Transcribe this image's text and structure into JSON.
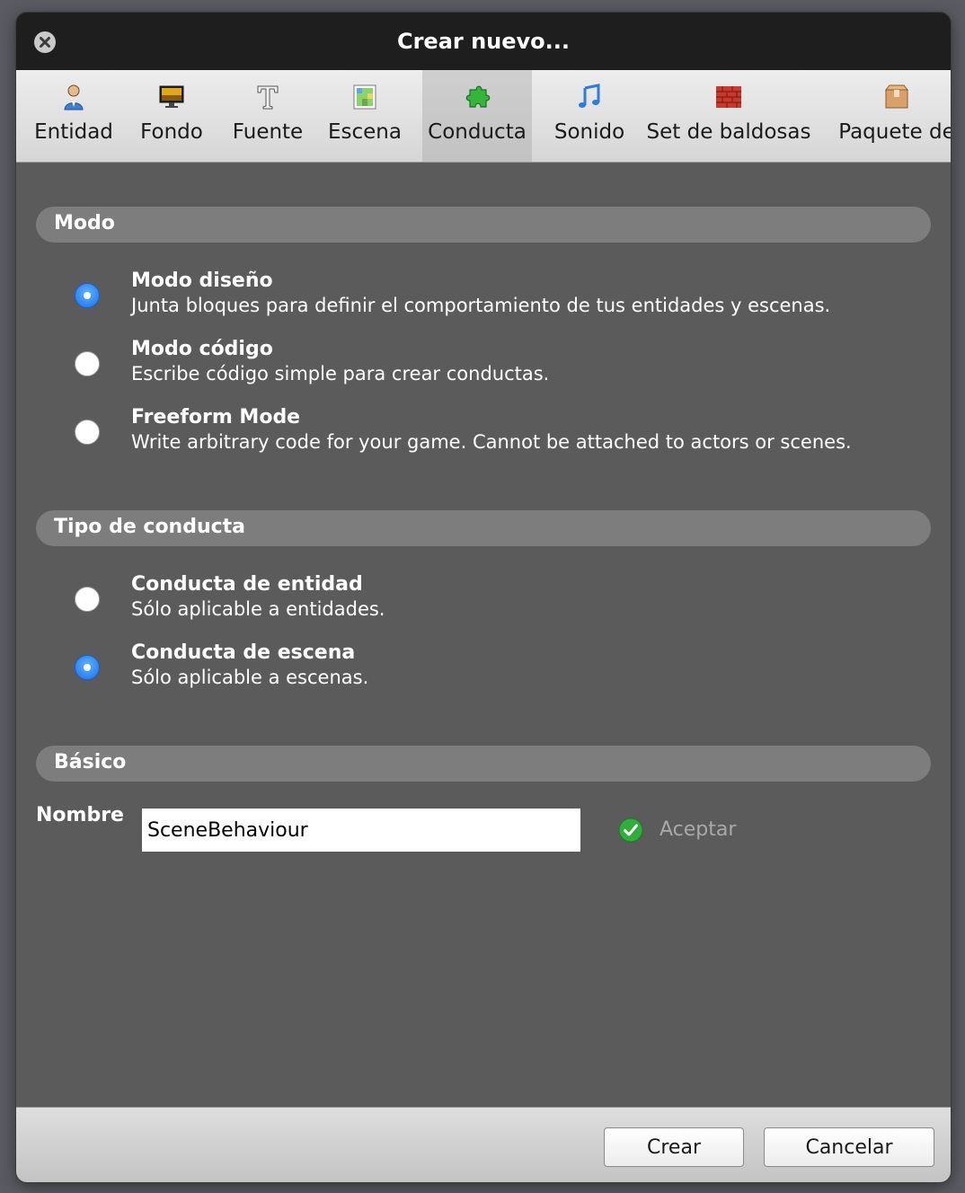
{
  "window": {
    "title": "Crear nuevo..."
  },
  "tabs": [
    {
      "label": "Entidad",
      "icon": "actor-icon"
    },
    {
      "label": "Fondo",
      "icon": "background-icon"
    },
    {
      "label": "Fuente",
      "icon": "font-icon"
    },
    {
      "label": "Escena",
      "icon": "scene-icon"
    },
    {
      "label": "Conducta",
      "icon": "behavior-icon",
      "active": true
    },
    {
      "label": "Sonido",
      "icon": "sound-icon"
    },
    {
      "label": "Set de baldosas",
      "icon": "tileset-icon"
    },
    {
      "label": "Paquete de",
      "icon": "package-icon"
    }
  ],
  "mode": {
    "header": "Modo",
    "options": [
      {
        "title": "Modo diseño",
        "desc": "Junta bloques para definir el comportamiento de tus entidades y escenas.",
        "checked": true
      },
      {
        "title": "Modo código",
        "desc": "Escribe código simple para crear conductas.",
        "checked": false
      },
      {
        "title": "Freeform Mode",
        "desc": "Write arbitrary code for your game. Cannot be attached to actors or scenes.",
        "checked": false
      }
    ]
  },
  "behavior_type": {
    "header": "Tipo de conducta",
    "options": [
      {
        "title": "Conducta de entidad",
        "desc": "Sólo aplicable a entidades.",
        "checked": false
      },
      {
        "title": "Conducta de escena",
        "desc": "Sólo aplicable a escenas.",
        "checked": true
      }
    ]
  },
  "basic": {
    "header": "Básico",
    "name_label": "Nombre",
    "name_value": "SceneBehaviour",
    "accept_label": "Aceptar"
  },
  "footer": {
    "create_label": "Crear",
    "cancel_label": "Cancelar"
  },
  "colors": {
    "panel_bg": "#5b5b5b",
    "section_header_bg": "#7d7d7d",
    "radio_selected": "#1a6ff2",
    "titlebar_bg": "#1e1e1e"
  }
}
